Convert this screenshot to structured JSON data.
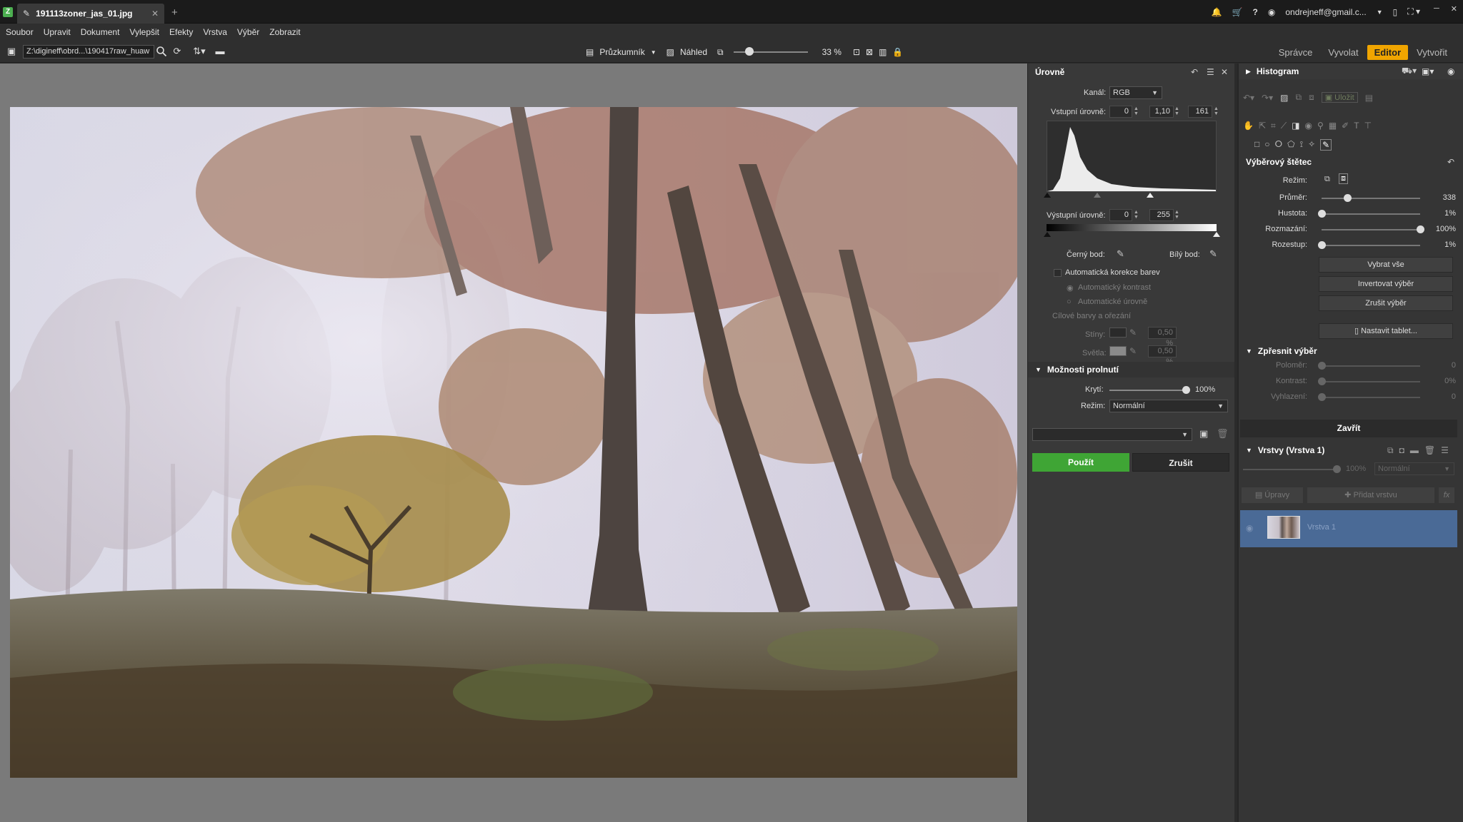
{
  "app": {
    "tab_title": "191113zoner_jas_01.jpg",
    "account": "ondrejneff@gmail.c..."
  },
  "menu": [
    "Soubor",
    "Upravit",
    "Dokument",
    "Vylepšit",
    "Efekty",
    "Vrstva",
    "Výběr",
    "Zobrazit"
  ],
  "toolbar": {
    "path": "Z:\\digineff\\obrd...\\190417raw_huaw",
    "explorer_label": "Průzkumník",
    "preview_label": "Náhled",
    "zoom_percent": "33 %",
    "zoom_level": 0.22
  },
  "modes": [
    {
      "label": "Správce",
      "active": false
    },
    {
      "label": "Vyvolat",
      "active": false
    },
    {
      "label": "Editor",
      "active": true
    },
    {
      "label": "Vytvořit",
      "active": false
    }
  ],
  "levels": {
    "title": "Úrovně",
    "channel_label": "Kanál:",
    "channel_value": "RGB",
    "input_label": "Vstupní úrovně:",
    "input_black": "0",
    "input_gamma": "1,10",
    "input_white": "161",
    "output_label": "Výstupní úrovně:",
    "output_black": "0",
    "output_white": "255",
    "black_point_label": "Černý bod:",
    "white_point_label": "Bílý bod:",
    "auto_color_label": "Automatická korekce barev",
    "auto_contrast_label": "Automatický kontrast",
    "auto_levels_label": "Automatické úrovně",
    "target_colors_label": "Cílové barvy a ořezání",
    "shadows_label": "Stíny:",
    "shadows_value": "0,50 %",
    "highlights_label": "Světla:",
    "highlights_value": "0,50 %"
  },
  "blend": {
    "title": "Možnosti prolnutí",
    "opacity_label": "Krytí:",
    "opacity_value": "100%",
    "mode_label": "Režim:",
    "mode_value": "Normální"
  },
  "actions": {
    "apply": "Použít",
    "cancel": "Zrušit"
  },
  "histogram_title": "Histogram",
  "save_label": "Uložit",
  "brush": {
    "title": "Výběrový štětec",
    "mode_label": "Režim:",
    "sliders": [
      {
        "label": "Průměr:",
        "value": "338",
        "pos": 0.26
      },
      {
        "label": "Hustota:",
        "value": "1%",
        "pos": 0.0
      },
      {
        "label": "Rozmazání:",
        "value": "100%",
        "pos": 1.0
      },
      {
        "label": "Rozestup:",
        "value": "1%",
        "pos": 0.0
      }
    ],
    "select_all": "Vybrat vše",
    "invert_selection": "Invertovat výběr",
    "cancel_selection": "Zrušit výběr",
    "tablet_settings": "Nastavit tablet..."
  },
  "refine": {
    "title": "Zpřesnit výběr",
    "sliders": [
      {
        "label": "Poloměr:",
        "value": "0"
      },
      {
        "label": "Kontrast:",
        "value": "0%"
      },
      {
        "label": "Vyhlazení:",
        "value": "0"
      }
    ]
  },
  "close_label": "Zavřít",
  "layers": {
    "title": "Vrstvy (Vrstva 1)",
    "opacity": "100%",
    "mode": "Normální",
    "adjustments_label": "Úpravy",
    "add_layer_label": "Přidat vrstvu",
    "layer_name": "Vrstva 1"
  },
  "colors": {
    "accent": "#f0a500",
    "apply_green": "#3fa535",
    "layer_selected": "#4a6a96"
  }
}
